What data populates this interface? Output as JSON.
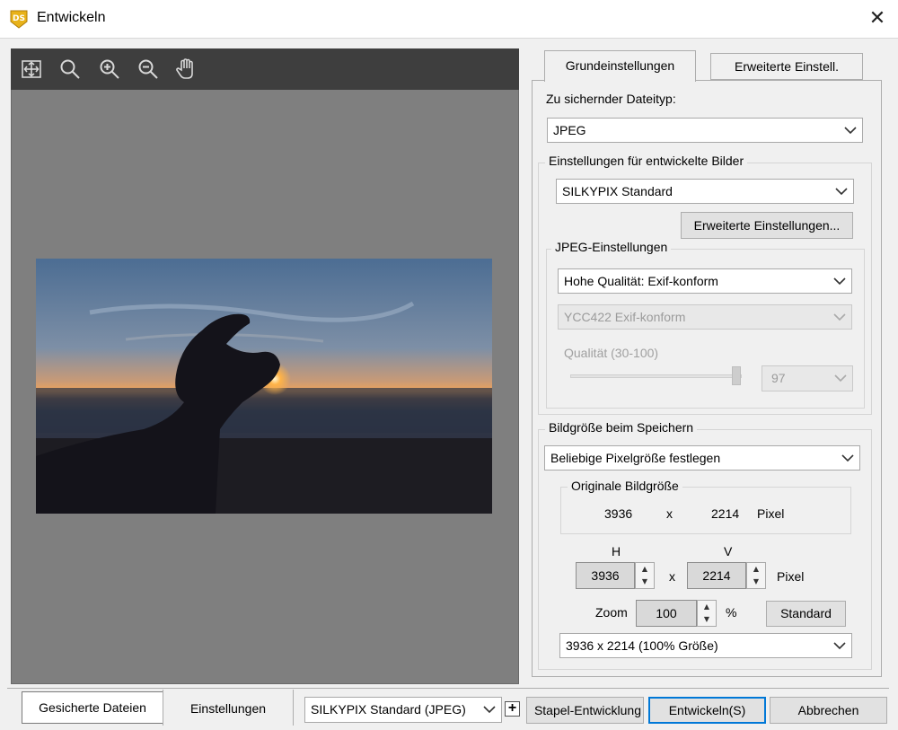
{
  "window": {
    "title": "Entwickeln",
    "close_glyph": "✕",
    "app_icon_text": "DS",
    "app_icon_color": "#e8b21a"
  },
  "preview": {
    "toolbar_icons": [
      "fit-view-icon",
      "magnifier-icon",
      "zoom-in-icon",
      "zoom-out-icon",
      "hand-pan-icon"
    ],
    "background": "#7f7f7f",
    "photo_description_colors": {
      "sky_top": "#4d6f95",
      "horizon": "#f0a35a",
      "sea": "#2b3548",
      "sand": "#1c1b22"
    }
  },
  "tabs": {
    "basic": "Grundeinstellungen",
    "advanced": "Erweiterte Einstell."
  },
  "basic": {
    "file_type_label": "Zu sichernder Dateityp:",
    "file_type_value": "JPEG",
    "developed_group_title": "Einstellungen für entwickelte Bilder",
    "profile_value": "SILKYPIX Standard",
    "advanced_settings_button": "Erweiterte Einstellungen...",
    "jpeg_group_title": "JPEG-Einstellungen",
    "jpeg_quality_mode": "Hohe Qualität: Exif-konform",
    "chroma_value": "YCC422 Exif-konform",
    "quality_label": "Qualität (30-100)",
    "quality_value": "97",
    "quality_slider_level": 0.97,
    "size_group_title": "Bildgröße beim Speichern",
    "size_mode_value": "Beliebige Pixelgröße festlegen",
    "original_group_title": "Originale Bildgröße",
    "original_w": "3936",
    "original_x": "x",
    "original_h": "2214",
    "original_unit": "Pixel",
    "h_label": "H",
    "v_label": "V",
    "h_value": "3936",
    "v_value": "2214",
    "hv_x": "x",
    "hv_unit": "Pixel",
    "zoom_label": "Zoom",
    "zoom_value": "100",
    "zoom_unit": "%",
    "standard_button": "Standard",
    "size_preset_value": "3936 x  2214  (100% Größe)"
  },
  "bottom": {
    "saved_files_tab": "Gesicherte Dateien",
    "settings_tab": "Einstellungen",
    "preset_value": "SILKYPIX Standard (JPEG)",
    "add_glyph": "+",
    "batch_button": "Stapel-Entwicklung",
    "develop_button": "Entwickeln(S)",
    "cancel_button": "Abbrechen"
  }
}
